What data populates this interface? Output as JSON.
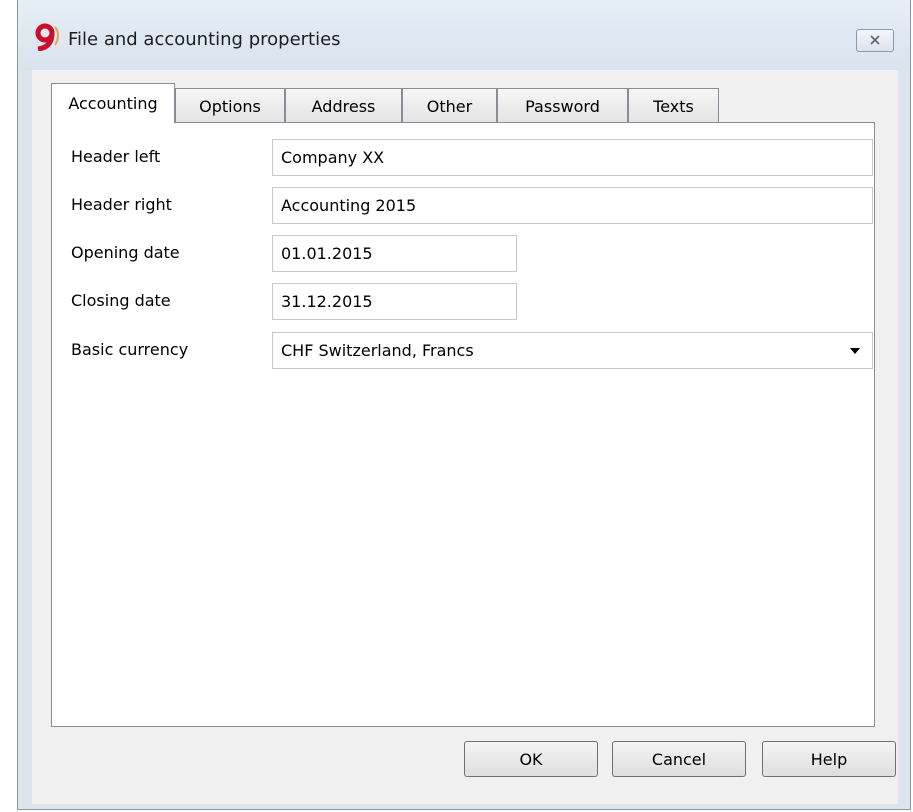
{
  "window": {
    "title": "File and accounting properties",
    "colors": {
      "frame": "#dce5ee",
      "client": "#f0f0f0",
      "icon_brand": "#c8102e"
    }
  },
  "tabs": [
    {
      "label": "Accounting",
      "active": true
    },
    {
      "label": "Options",
      "active": false
    },
    {
      "label": "Address",
      "active": false
    },
    {
      "label": "Other",
      "active": false
    },
    {
      "label": "Password",
      "active": false
    },
    {
      "label": "Texts",
      "active": false
    }
  ],
  "form": {
    "header_left": {
      "label": "Header left",
      "value": "Company XX"
    },
    "header_right": {
      "label": "Header right",
      "value": "Accounting 2015"
    },
    "opening_date": {
      "label": "Opening date",
      "value": "01.01.2015"
    },
    "closing_date": {
      "label": "Closing date",
      "value": "31.12.2015"
    },
    "basic_currency": {
      "label": "Basic currency",
      "value": "CHF Switzerland, Francs"
    }
  },
  "buttons": {
    "ok": "OK",
    "cancel": "Cancel",
    "help": "Help"
  }
}
